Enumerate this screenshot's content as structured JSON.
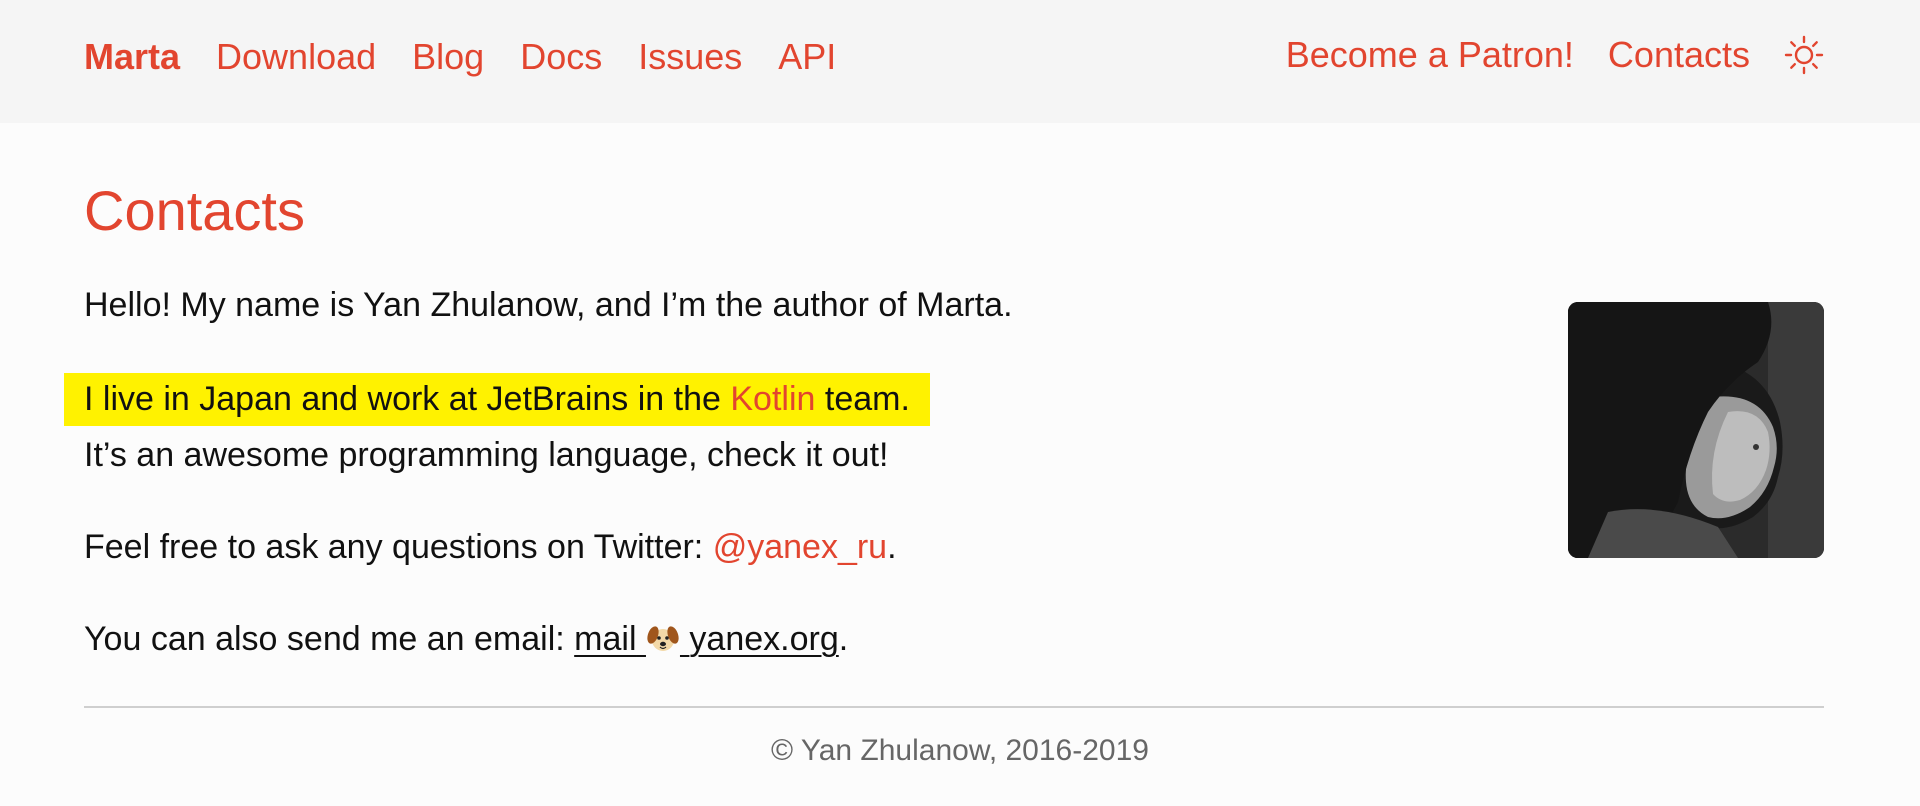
{
  "nav": {
    "brand": "Marta",
    "links": [
      "Download",
      "Blog",
      "Docs",
      "Issues",
      "API"
    ],
    "right_links": [
      "Become a Patron!",
      "Contacts"
    ],
    "theme_toggle_icon": "sun-icon"
  },
  "page": {
    "title": "Contacts",
    "p1": "Hello! My name is Yan Zhulanow, and I’m the author of Marta.",
    "p2_before": "I live in Japan and work at JetBrains in the ",
    "p2_link": "Kotlin",
    "p2_after": " team.",
    "p3": "It’s an awesome programming language, check it out!",
    "p4_before": "Feel free to ask any questions on Twitter: ",
    "p4_link": "@yanex_ru",
    "p4_after": ".",
    "p5_before": "You can also send me an email: ",
    "p5_mail_user": "mail",
    "p5_mail_icon": "dog-face-icon",
    "p5_mail_domain": "yanex.org",
    "p5_after": "."
  },
  "footer": {
    "text": "© Yan Zhulanow, 2016-2019"
  },
  "colors": {
    "accent": "#e2452f",
    "highlight": "#fff200",
    "topbar_bg": "#f5f5f5",
    "page_bg": "#fcfcfc"
  }
}
